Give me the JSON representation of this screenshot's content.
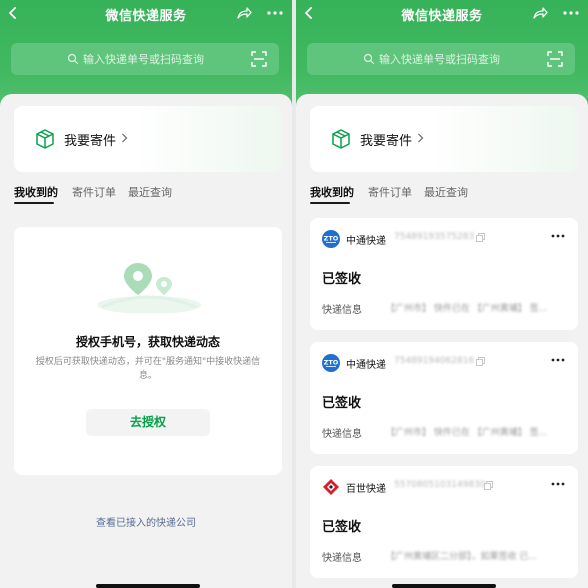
{
  "app_title": "微信快递服务",
  "search": {
    "placeholder": "输入快递单号或扫码查询"
  },
  "send": {
    "label": "我要寄件"
  },
  "tabs": [
    {
      "label": "我收到的",
      "active": true
    },
    {
      "label": "寄件订单",
      "active": false
    },
    {
      "label": "最近查询",
      "active": false
    }
  ],
  "auth": {
    "title": "授权手机号，获取快递动态",
    "description": "授权后可获取快递动态，并可在\"服务通知\"中接收快递信息。",
    "button_label": "去授权"
  },
  "companies_link": "查看已接入的快递公司",
  "packages": [
    {
      "carrier": "中通快递",
      "logo": "zto-logo-icon",
      "tracking": "75489193575283",
      "status": "已签收",
      "info_label": "快递信息",
      "info_text": "【广州市】 快件已在 【广州黄埔】 签..."
    },
    {
      "carrier": "中通快递",
      "logo": "zto-logo-icon",
      "tracking": "75489194062816",
      "status": "已签收",
      "info_label": "快递信息",
      "info_text": "【广州市】 快件已在 【广州黄埔】 签..."
    },
    {
      "carrier": "百世快递",
      "logo": "best-express-logo-icon",
      "tracking": "5570805103149830",
      "status": "已签收",
      "info_label": "快递信息",
      "info_text": "【广州黄埔区二分部】，如果签收 已..."
    }
  ],
  "colors": {
    "header_green": "#36b259",
    "accent_green": "#07a14a",
    "link_blue": "#576b95"
  }
}
